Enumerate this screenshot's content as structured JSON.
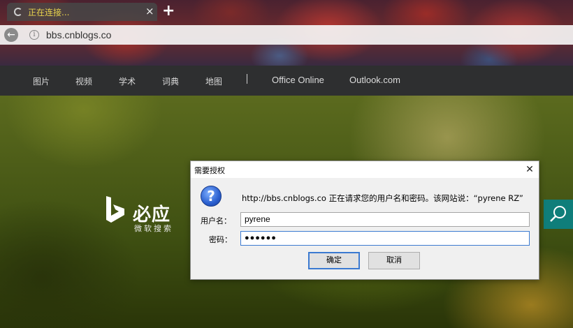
{
  "browser": {
    "tab_title": "正在连接...",
    "tab_close": "×",
    "new_tab": "+",
    "url": "bbs.cnblogs.co",
    "info_glyph": "i",
    "back_glyph": "←"
  },
  "nav": {
    "items": [
      "图片",
      "视频",
      "学术",
      "词典",
      "地图"
    ],
    "links": [
      "Office Online",
      "Outlook.com"
    ]
  },
  "bing": {
    "name": "必应",
    "subtitle": "微软搜索"
  },
  "dialog": {
    "title": "需要授权",
    "close_glyph": "✕",
    "help_glyph": "?",
    "message": "http://bbs.cnblogs.co 正在请求您的用户名和密码。该网站说：“pyrene RZ”",
    "username_label": "用户名：",
    "username_value": "pyrene",
    "password_label": "密码：",
    "password_value": "●●●●●●",
    "ok_label": "确定",
    "cancel_label": "取消"
  }
}
